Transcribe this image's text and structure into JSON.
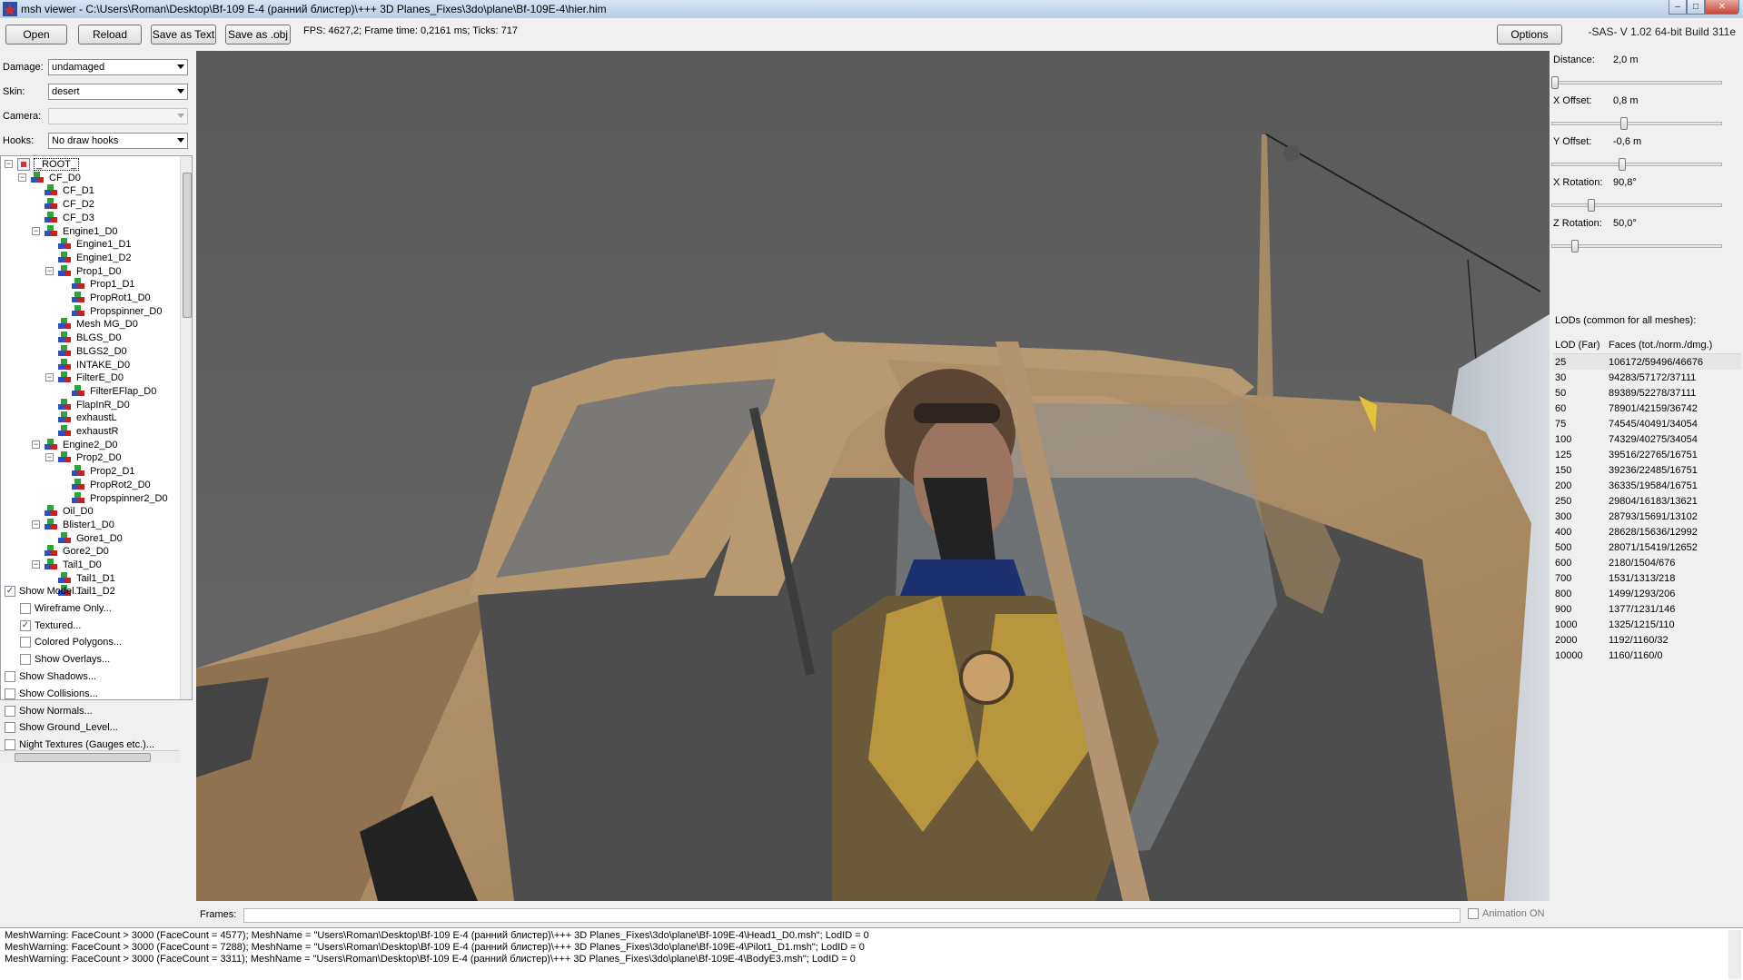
{
  "window": {
    "title": "msh viewer - C:\\Users\\Roman\\Desktop\\Bf-109 E-4 (ранний блистер)\\+++ 3D Planes_Fixes\\3do\\plane\\Bf-109E-4\\hier.him",
    "minimize": "–",
    "maximize": "□",
    "close": "✕"
  },
  "toolbar": {
    "open": "Open",
    "reload": "Reload",
    "save_text": "Save as Text",
    "save_obj": "Save as .obj",
    "status": "FPS: 4627,2; Frame time: 0,2161 ms; Ticks: 717",
    "options": "Options",
    "version": "-SAS- V 1.02  64-bit  Build 311e"
  },
  "left": {
    "damage_label": "Damage:",
    "damage_value": "undamaged",
    "skin_label": "Skin:",
    "skin_value": "desert",
    "camera_label": "Camera:",
    "camera_value": "",
    "hooks_label": "Hooks:",
    "hooks_value": "No draw hooks"
  },
  "tree": [
    {
      "label": "_ROOT_",
      "level": 0,
      "expander": "−",
      "root": true
    },
    {
      "label": "CF_D0",
      "level": 1,
      "expander": "−"
    },
    {
      "label": "CF_D1",
      "level": 2
    },
    {
      "label": "CF_D2",
      "level": 2
    },
    {
      "label": "CF_D3",
      "level": 2
    },
    {
      "label": "Engine1_D0",
      "level": 2,
      "expander": "−"
    },
    {
      "label": "Engine1_D1",
      "level": 3
    },
    {
      "label": "Engine1_D2",
      "level": 3
    },
    {
      "label": "Prop1_D0",
      "level": 3,
      "expander": "−"
    },
    {
      "label": "Prop1_D1",
      "level": 4
    },
    {
      "label": "PropRot1_D0",
      "level": 4
    },
    {
      "label": "Propspinner_D0",
      "level": 4
    },
    {
      "label": "Mesh MG_D0",
      "level": 3
    },
    {
      "label": "BLGS_D0",
      "level": 3
    },
    {
      "label": "BLGS2_D0",
      "level": 3
    },
    {
      "label": "INTAKE_D0",
      "level": 3
    },
    {
      "label": "FilterE_D0",
      "level": 3,
      "expander": "−"
    },
    {
      "label": "FilterEFlap_D0",
      "level": 4
    },
    {
      "label": "FlapInR_D0",
      "level": 3
    },
    {
      "label": "exhaustL",
      "level": 3
    },
    {
      "label": "exhaustR",
      "level": 3
    },
    {
      "label": "Engine2_D0",
      "level": 2,
      "expander": "−"
    },
    {
      "label": "Prop2_D0",
      "level": 3,
      "expander": "−"
    },
    {
      "label": "Prop2_D1",
      "level": 4
    },
    {
      "label": "PropRot2_D0",
      "level": 4
    },
    {
      "label": "Propspinner2_D0",
      "level": 4
    },
    {
      "label": "Oil_D0",
      "level": 2
    },
    {
      "label": "Blister1_D0",
      "level": 2,
      "expander": "−"
    },
    {
      "label": "Gore1_D0",
      "level": 3
    },
    {
      "label": "Gore2_D0",
      "level": 2
    },
    {
      "label": "Tail1_D0",
      "level": 2,
      "expander": "−"
    },
    {
      "label": "Tail1_D1",
      "level": 3
    },
    {
      "label": "Tail1_D2",
      "level": 3
    }
  ],
  "checks": [
    {
      "label": "Show Model...",
      "checked": true,
      "indent": 0
    },
    {
      "label": "Wireframe Only...",
      "checked": false,
      "indent": 1
    },
    {
      "label": "Textured...",
      "checked": true,
      "indent": 1
    },
    {
      "label": "Colored Polygons...",
      "checked": false,
      "indent": 1
    },
    {
      "label": "Show Overlays...",
      "checked": false,
      "indent": 1
    },
    {
      "label": "Show Shadows...",
      "checked": false,
      "indent": 0
    },
    {
      "label": "Show Collisions...",
      "checked": false,
      "indent": 0
    },
    {
      "label": "Show Normals...",
      "checked": false,
      "indent": 0
    },
    {
      "label": "Show Ground_Level...",
      "checked": false,
      "indent": 0
    },
    {
      "label": "Night Textures (Gauges etc.)...",
      "checked": false,
      "indent": 0
    }
  ],
  "frames": {
    "label": "Frames:",
    "animation_label": "Animation ON",
    "animation_on": false
  },
  "camera_controls": [
    {
      "label": "Distance:",
      "value": "2,0 m",
      "fraction": 0.0
    },
    {
      "label": "X Offset:",
      "value": "0,8 m",
      "fraction": 0.42
    },
    {
      "label": "Y Offset:",
      "value": "-0,6 m",
      "fraction": 0.41
    },
    {
      "label": "X Rotation:",
      "value": "90,8°",
      "fraction": 0.22
    },
    {
      "label": "Z Rotation:",
      "value": "50,0°",
      "fraction": 0.12
    }
  ],
  "lods": {
    "title": "LODs (common for all meshes):",
    "col_lod": "LOD (Far)",
    "col_faces": "Faces (tot./norm./dmg.)",
    "rows": [
      {
        "lod": "25",
        "faces": "106172/59496/46676"
      },
      {
        "lod": "30",
        "faces": "94283/57172/37111"
      },
      {
        "lod": "50",
        "faces": "89389/52278/37111"
      },
      {
        "lod": "60",
        "faces": "78901/42159/36742"
      },
      {
        "lod": "75",
        "faces": "74545/40491/34054"
      },
      {
        "lod": "100",
        "faces": "74329/40275/34054"
      },
      {
        "lod": "125",
        "faces": "39516/22765/16751"
      },
      {
        "lod": "150",
        "faces": "39236/22485/16751"
      },
      {
        "lod": "200",
        "faces": "36335/19584/16751"
      },
      {
        "lod": "250",
        "faces": "29804/16183/13621"
      },
      {
        "lod": "300",
        "faces": "28793/15691/13102"
      },
      {
        "lod": "400",
        "faces": "28628/15636/12992"
      },
      {
        "lod": "500",
        "faces": "28071/15419/12652"
      },
      {
        "lod": "600",
        "faces": "2180/1504/676"
      },
      {
        "lod": "700",
        "faces": "1531/1313/218"
      },
      {
        "lod": "800",
        "faces": "1499/1293/206"
      },
      {
        "lod": "900",
        "faces": "1377/1231/146"
      },
      {
        "lod": "1000",
        "faces": "1325/1215/110"
      },
      {
        "lod": "2000",
        "faces": "1192/1160/32"
      },
      {
        "lod": "10000",
        "faces": "1160/1160/0"
      }
    ]
  },
  "log": [
    "MeshWarning: FaceCount > 3000 (FaceCount = 4577); MeshName = \"Users\\Roman\\Desktop\\Bf-109 E-4 (ранний блистер)\\+++ 3D Planes_Fixes\\3do\\plane\\Bf-109E-4\\Head1_D0.msh\"; LodID = 0",
    "MeshWarning: FaceCount > 3000 (FaceCount = 7288); MeshName = \"Users\\Roman\\Desktop\\Bf-109 E-4 (ранний блистер)\\+++ 3D Planes_Fixes\\3do\\plane\\Bf-109E-4\\Pilot1_D1.msh\"; LodID = 0",
    "MeshWarning: FaceCount > 3000 (FaceCount = 3311); MeshName = \"Users\\Roman\\Desktop\\Bf-109 E-4 (ранний блистер)\\+++ 3D Planes_Fixes\\3do\\plane\\Bf-109E-4\\BodyE3.msh\"; LodID = 0"
  ]
}
